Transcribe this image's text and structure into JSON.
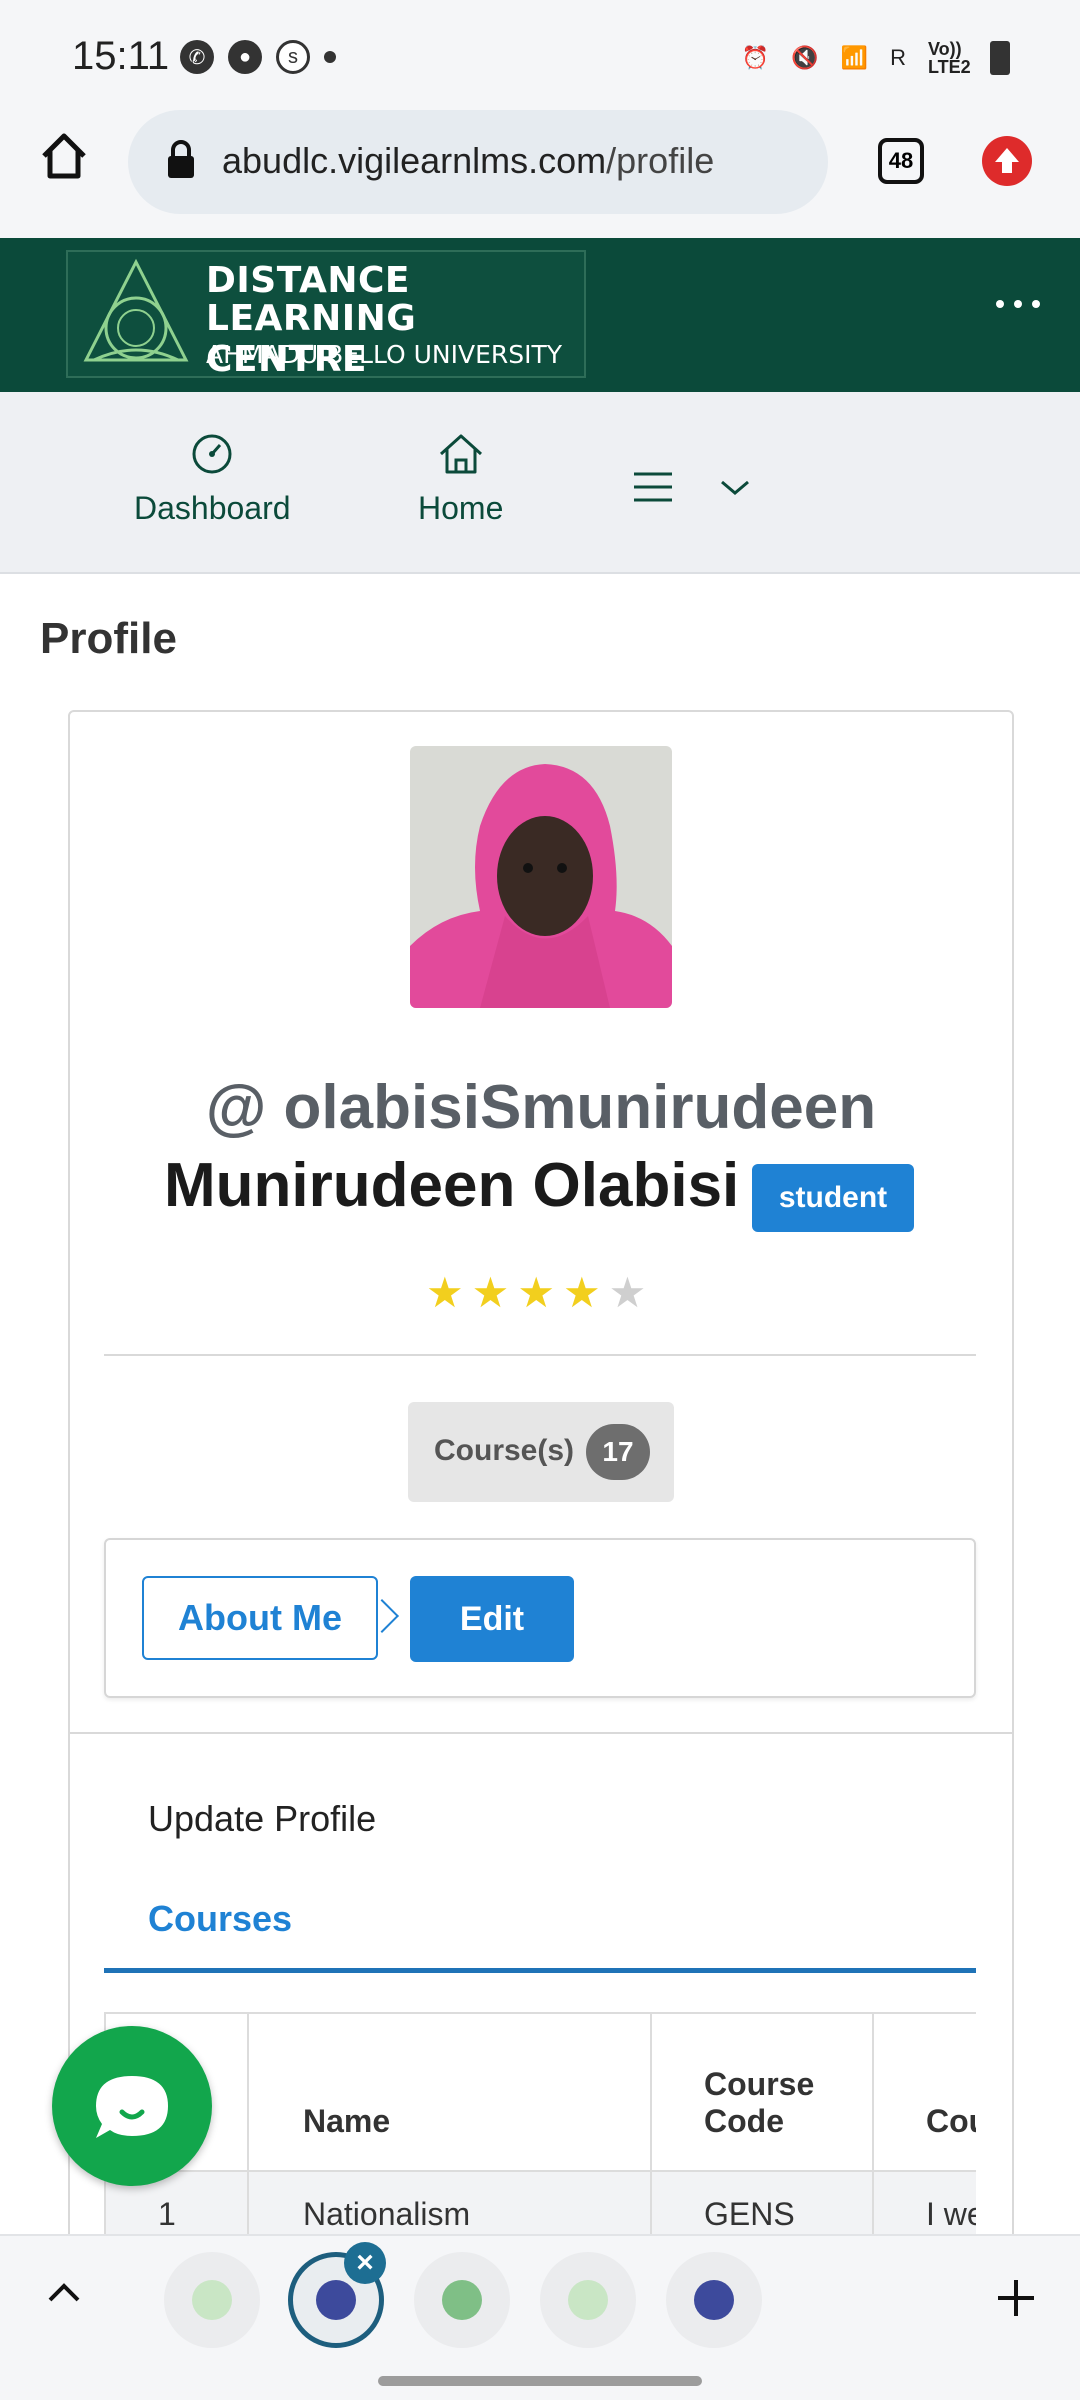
{
  "status_bar": {
    "time": "15:11",
    "signal_text": "Vo)) LTE2",
    "network_r": "R"
  },
  "browser": {
    "url_domain": "abudlc.vigilearnlms.com",
    "url_path": "/profile",
    "tab_count": "48"
  },
  "site_header": {
    "logo_line1": "DISTANCE",
    "logo_line2": "LEARNING CENTRE",
    "logo_line3": "AHMADU BELLO UNIVERSITY"
  },
  "nav": {
    "dashboard_label": "Dashboard",
    "home_label": "Home"
  },
  "page": {
    "title": "Profile"
  },
  "profile": {
    "username": "@ olabisiSmunirudeen",
    "full_name": "Munirudeen Olabisi",
    "role": "student",
    "rating": 4,
    "rating_max": 5,
    "courses_label": "Course(s)",
    "courses_count": "17",
    "about_me_label": "About Me",
    "edit_label": "Edit",
    "update_profile_label": "Update Profile",
    "courses_tab_label": "Courses"
  },
  "table": {
    "headers": [
      "",
      "Name",
      "Course Code",
      "Cou"
    ],
    "rows": [
      [
        "1",
        "Nationalism",
        "GENS",
        "I we"
      ]
    ]
  },
  "colors": {
    "header_green": "#0b4a3a",
    "accent_blue": "#1f82d4",
    "chat_green": "#12a64c"
  }
}
